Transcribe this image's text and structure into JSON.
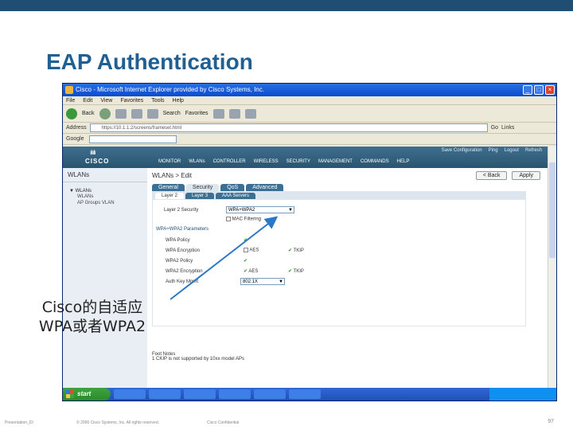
{
  "slide": {
    "title": "EAP Authentication",
    "callout_line1": "Cisco的自适应",
    "callout_line2": "WPA或者WPA2",
    "footer_left": "Presentation_ID",
    "footer_copy": "© 2006 Cisco Systems, Inc. All rights reserved.",
    "footer_conf": "Cisco Confidential",
    "page_number": "97"
  },
  "browser": {
    "title": "Cisco - Microsoft Internet Explorer provided by Cisco Systems, Inc.",
    "menu": [
      "File",
      "Edit",
      "View",
      "Favorites",
      "Tools",
      "Help"
    ],
    "toolbar": {
      "back": "Back",
      "search": "Search",
      "favorites": "Favorites"
    },
    "address_label": "Address",
    "address_value": "https://10.1.1.2/screens/frameset.html",
    "go_label": "Go",
    "links_label": "Links",
    "google_label": "Google"
  },
  "wlc": {
    "logo": "CISCO",
    "header_links": [
      "Save Configuration",
      "Ping",
      "Logout",
      "Refresh"
    ],
    "nav": [
      "MONITOR",
      "WLANs",
      "CONTROLLER",
      "WIRELESS",
      "SECURITY",
      "MANAGEMENT",
      "COMMANDS",
      "HELP"
    ],
    "left_heading": "WLANs",
    "left_top": "▼ WLANs",
    "left_items": [
      "WLANs",
      "AP Groups VLAN"
    ],
    "breadcrumb": "WLANs > Edit",
    "back_btn": "< Back",
    "apply_btn": "Apply",
    "tabs": [
      "General",
      "Security",
      "QoS",
      "Advanced"
    ],
    "subtabs": [
      "Layer 2",
      "Layer 3",
      "AAA Servers"
    ],
    "l2_security_label": "Layer 2 Security",
    "l2_security_value": "WPA+WPA2",
    "mac_filtering": "MAC Filtering",
    "params_heading": "WPA+WPA2 Parameters",
    "rows": [
      {
        "label": "WPA Policy",
        "c1": "",
        "c2": ""
      },
      {
        "label": "WPA Encryption",
        "c1": "AES",
        "c2": "TKIP"
      },
      {
        "label": "WPA2 Policy",
        "c1": "",
        "c2": ""
      },
      {
        "label": "WPA2 Encryption",
        "c1": "AES",
        "c2": "TKIP"
      },
      {
        "label": "Auth Key Mgmt",
        "c1": "802.1X",
        "c2": ""
      }
    ],
    "foot_heading": "Foot Notes",
    "foot_text": "1 CKIP is not supported by 10xx model APs"
  },
  "taskbar": {
    "start": "start",
    "items": [
      "",
      "",
      "",
      "",
      "",
      "",
      ""
    ],
    "tray": ""
  }
}
